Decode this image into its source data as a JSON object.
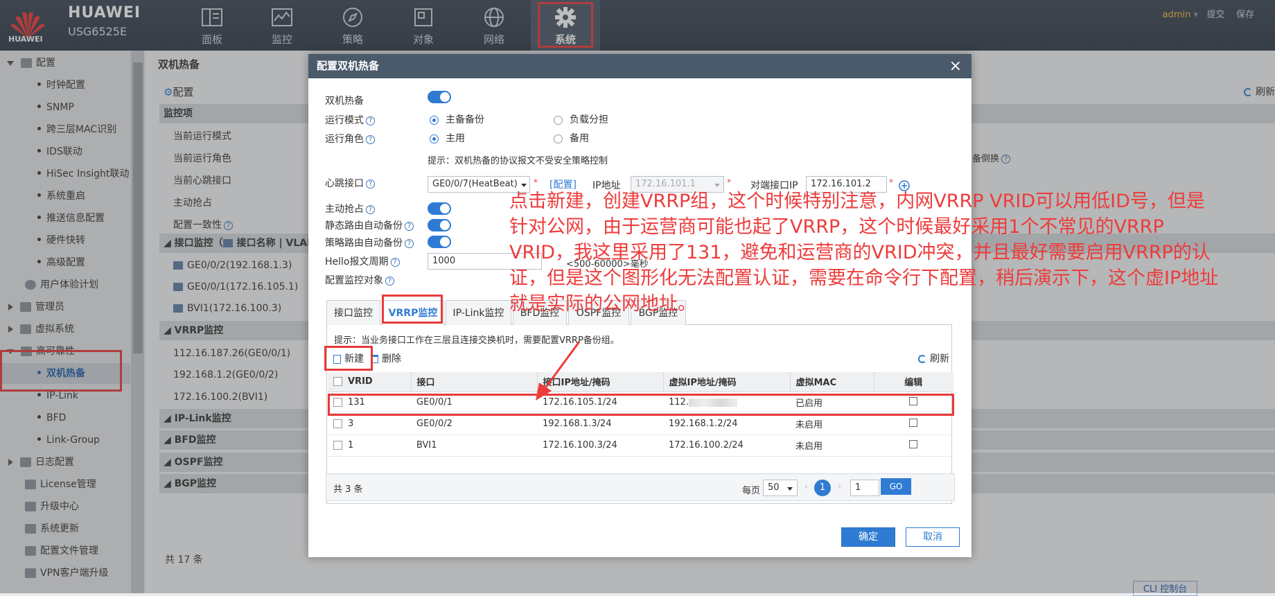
{
  "topbar": {
    "brand": "HUAWEI",
    "model": "USG6525E",
    "brand_small": "HUAWEI",
    "nav": [
      {
        "label": "面板",
        "icon": "dashboard-icon"
      },
      {
        "label": "监控",
        "icon": "monitor-icon"
      },
      {
        "label": "策略",
        "icon": "policy-icon"
      },
      {
        "label": "对象",
        "icon": "object-icon"
      },
      {
        "label": "网络",
        "icon": "network-icon"
      },
      {
        "label": "系统",
        "icon": "gear-icon"
      }
    ],
    "user": "admin",
    "commit": "提交",
    "save": "保存"
  },
  "sidebar": {
    "items": [
      {
        "label": "配置"
      },
      {
        "label": "时钟配置"
      },
      {
        "label": "SNMP"
      },
      {
        "label": "跨三层MAC识别"
      },
      {
        "label": "IDS联动"
      },
      {
        "label": "HiSec Insight联动"
      },
      {
        "label": "系统重启"
      },
      {
        "label": "推送信息配置"
      },
      {
        "label": "硬件快转"
      },
      {
        "label": "高级配置"
      },
      {
        "label": "用户体验计划"
      },
      {
        "label": "管理员"
      },
      {
        "label": "虚拟系统"
      },
      {
        "label": "高可靠性"
      },
      {
        "label": "双机热备"
      },
      {
        "label": "IP-Link"
      },
      {
        "label": "BFD"
      },
      {
        "label": "Link-Group"
      },
      {
        "label": "日志配置"
      },
      {
        "label": "License管理"
      },
      {
        "label": "升级中心"
      },
      {
        "label": "系统更新"
      },
      {
        "label": "配置文件管理"
      },
      {
        "label": "VPN客户端升级"
      }
    ]
  },
  "background": {
    "title": "双机热备",
    "config_label": "配置",
    "refresh": "刷新",
    "monitor_header": "监控项",
    "rows": [
      "当前运行模式",
      "当前运行角色",
      "当前心跳接口",
      "主动抢占",
      "配置一致性"
    ],
    "peer_hint": "主备倒换",
    "iface_header": "接口监控（",
    "iface_header2": "接口名称 | VLAN",
    "ifaces": [
      "GE0/0/2(192.168.1.3)",
      "GE0/0/1(172.16.105.1)",
      "BVI1(172.16.100.3)"
    ],
    "vrrp_header": "VRRP监控",
    "vrrp_rows": [
      "112.16.187.26(GE0/0/1)",
      "192.168.1.2(GE0/0/2)",
      "172.16.100.2(BVI1)"
    ],
    "sections": [
      "IP-Link监控",
      "BFD监控",
      "OSPF监控",
      "BGP监控"
    ],
    "total": "共 17 条",
    "cli": "CLI 控制台"
  },
  "modal": {
    "title": "配置双机热备",
    "close": "×",
    "hot_standby_label": "双机热备",
    "mode_label": "运行模式",
    "mode_options": [
      "主备备份",
      "负载分担"
    ],
    "role_label": "运行角色",
    "role_options": [
      "主用",
      "备用"
    ],
    "hint": "提示：双机热备的协议报文不受安全策略控制",
    "heartbeat_label": "心跳接口",
    "heartbeat_value": "GE0/0/7(HeatBeat)",
    "config_link": "[配置]",
    "ip_label": "IP地址",
    "ip_value": "172.16.101.1",
    "peer_ip_label": "对端接口IP",
    "peer_ip_value": "172.16.101.2",
    "preempt_label": "主动抢占",
    "static_route_label": "静态路由自动备份",
    "policy_route_label": "策略路由自动备份",
    "hello_label": "Hello报文周期",
    "hello_value": "1000",
    "hello_range": "<500-60000>毫秒",
    "monitor_label": "配置监控对象",
    "tabs": [
      "接口监控",
      "VRRP监控",
      "IP-Link监控",
      "BFD监控",
      "OSPF监控",
      "BGP监控"
    ],
    "tab_hint": "提示：当业务接口工作在三层且连接交换机时，需要配置VRRP备份组。",
    "new": "新建",
    "delete": "删除",
    "refresh": "刷新",
    "columns": [
      "VRID",
      "接口",
      "接口IP地址/掩码",
      "虚拟IP地址/掩码",
      "虚拟MAC",
      "编辑"
    ],
    "rows": [
      {
        "vrid": "131",
        "iface": "GE0/0/1",
        "ip": "172.16.105.1/24",
        "vip": "112.",
        "mac": "已启用"
      },
      {
        "vrid": "3",
        "iface": "GE0/0/2",
        "ip": "192.168.1.3/24",
        "vip": "192.168.1.2/24",
        "mac": "未启用"
      },
      {
        "vrid": "1",
        "iface": "BVI1",
        "ip": "172.16.100.3/24",
        "vip": "172.16.100.2/24",
        "mac": "未启用"
      }
    ],
    "total": "共 3 条",
    "per_page_label": "每页",
    "per_page": "50",
    "page": "1",
    "page_input": "1",
    "go": "GO",
    "ok": "确定",
    "cancel": "取消"
  },
  "annotation": "点击新建，创建VRRP组，这个时候特别注意，内网VRRP VRID可以用低ID号，但是针对公网，由于运营商可能也起了VRRP，这个时候最好采用1个不常见的VRRP VRID，我这里采用了131，避免和运营商的VRID冲突，并且最好需要启用VRRP的认证，但是这个图形化无法配置认证，需要在命令行下配置，稍后演示下，这个虚IP地址就是实际的公网地址。",
  "colors": {
    "accent": "#2f7bd3",
    "highlight": "#e8393a",
    "topbar": "#2f3a48",
    "annotation": "#ee3b3b"
  }
}
